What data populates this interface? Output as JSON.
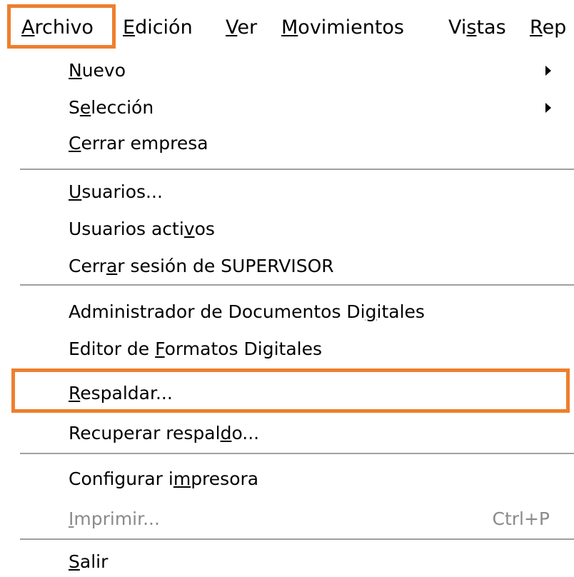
{
  "menubar": {
    "items": [
      {
        "label": "Archivo",
        "mnemonic": "A"
      },
      {
        "label": "Edición",
        "mnemonic": "E"
      },
      {
        "label": "Ver",
        "mnemonic": "V"
      },
      {
        "label": "Movimientos",
        "mnemonic": "M"
      },
      {
        "label": "Vistas",
        "mnemonic": "s"
      },
      {
        "label": "Rep",
        "mnemonic": "R"
      }
    ]
  },
  "menu": {
    "items": [
      {
        "pre": "",
        "mn": "N",
        "post": "uevo",
        "submenu": true
      },
      {
        "pre": "S",
        "mn": "e",
        "post": "lección",
        "submenu": true
      },
      {
        "pre": "",
        "mn": "C",
        "post": "errar empresa"
      },
      {
        "pre": "",
        "mn": "U",
        "post": "suarios..."
      },
      {
        "pre": "Usuarios acti",
        "mn": "v",
        "post": "os"
      },
      {
        "pre": "Cerr",
        "mn": "a",
        "post": "r sesión de SUPERVISOR"
      },
      {
        "pre": "Administrador de Documentos Di",
        "mn": "g",
        "post": "itales"
      },
      {
        "pre": "Editor de ",
        "mn": "F",
        "post": "ormatos Digitales"
      },
      {
        "pre": "",
        "mn": "R",
        "post": "espaldar..."
      },
      {
        "pre": "Recuperar respal",
        "mn": "d",
        "post": "o..."
      },
      {
        "pre": "Configurar i",
        "mn": "m",
        "post": "presora"
      },
      {
        "pre": "",
        "mn": "I",
        "post": "mprimir...",
        "disabled": true,
        "shortcut": "Ctrl+P"
      },
      {
        "pre": "",
        "mn": "S",
        "post": "alir"
      }
    ]
  },
  "colors": {
    "highlight": "#ee7f2d",
    "disabled_text": "#8a8a8a",
    "separator": "#a0a0a0"
  }
}
